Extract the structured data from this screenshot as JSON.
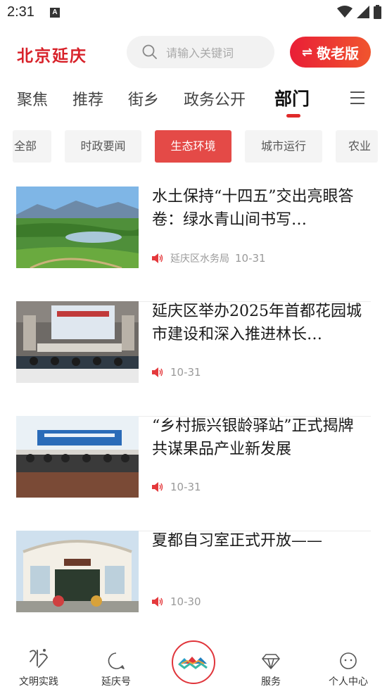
{
  "status_bar": {
    "time": "2:31",
    "notification_icon": "A"
  },
  "header": {
    "brand": "北京延庆",
    "search_placeholder": "请输入关键词",
    "elder_mode_label": "敬老版"
  },
  "category_tabs": [
    {
      "label": "聚焦"
    },
    {
      "label": "推荐"
    },
    {
      "label": "街乡"
    },
    {
      "label": "政务公开"
    },
    {
      "label": "部门",
      "active": true
    }
  ],
  "sub_tabs": [
    {
      "label": "全部"
    },
    {
      "label": "时政要闻"
    },
    {
      "label": "生态环境",
      "active": true
    },
    {
      "label": "城市运行"
    },
    {
      "label": "农业"
    }
  ],
  "news": [
    {
      "title": "水土保持“十四五”交出亮眼答卷：绿水青山间书写…",
      "source": "延庆区水务局",
      "date": "10-31",
      "thumb": "landscape-wetland"
    },
    {
      "title": "延庆区举办2025年首都花园城市建设和深入推进林长…",
      "source": "",
      "date": "10-31",
      "thumb": "meeting-hall"
    },
    {
      "title": "“乡村振兴银龄驿站”正式揭牌 共谋果品产业新发展",
      "source": "",
      "date": "10-31",
      "thumb": "conference-room"
    },
    {
      "title": "夏都自习室正式开放——",
      "source": "",
      "date": "10-30",
      "thumb": "building-entrance"
    }
  ],
  "bottom_nav": [
    {
      "label": "文明实践",
      "icon": "calligraphy-icon"
    },
    {
      "label": "延庆号",
      "icon": "chat-bubble-icon"
    },
    {
      "label": "",
      "icon": "mountain-logo-icon"
    },
    {
      "label": "服务",
      "icon": "diamond-icon"
    },
    {
      "label": "个人中心",
      "icon": "face-icon"
    }
  ],
  "colors": {
    "accent": "#e02a2a",
    "brand": "#d8222a",
    "active_chip": "#e44a47"
  }
}
